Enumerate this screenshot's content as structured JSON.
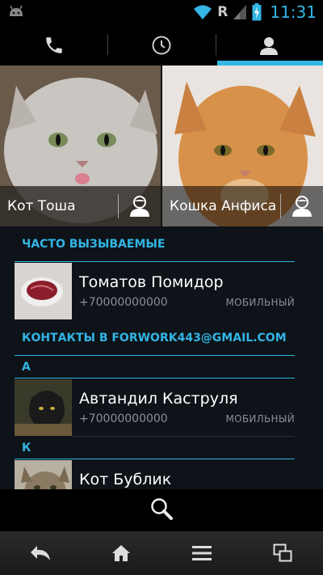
{
  "status_bar": {
    "roaming_indicator": "R",
    "time": "11:31",
    "icons": [
      "android-icon",
      "wifi-icon",
      "signal-icon",
      "battery-charging-icon"
    ]
  },
  "tabs": [
    {
      "name": "phone",
      "icon": "phone-icon",
      "active": false
    },
    {
      "name": "call-log",
      "icon": "clock-icon",
      "active": false
    },
    {
      "name": "contacts",
      "icon": "person-icon",
      "active": true
    }
  ],
  "favorites": [
    {
      "name": "Кот Тоша",
      "icon": "contact-card-icon"
    },
    {
      "name": "Кошка Анфиса",
      "icon": "contact-card-icon"
    }
  ],
  "frequent": {
    "header": "ЧАСТО ВЫЗЫВАЕМЫЕ",
    "items": [
      {
        "name": "Томатов Помидор",
        "phone": "+70000000000",
        "type": "МОБИЛЬНЫЙ"
      }
    ]
  },
  "account": {
    "header": "КОНТАКТЫ В FORWORK443@GMAIL.COM",
    "groups": [
      {
        "letter": "А",
        "items": [
          {
            "name": "Автандил Каструля",
            "phone": "+70000000000",
            "type": "МОБИЛЬНЫЙ"
          }
        ]
      },
      {
        "letter": "К",
        "items": [
          {
            "name": "Кот Бублик"
          }
        ]
      }
    ]
  },
  "action_bar": {
    "icon": "search-icon"
  },
  "nav_bar": {
    "icons": [
      "back-icon",
      "home-icon",
      "menu-icon",
      "recent-apps-icon"
    ]
  },
  "colors": {
    "accent": "#33b5e5",
    "list_bg": "#0d1318",
    "secondary_text": "#8a8f93"
  }
}
